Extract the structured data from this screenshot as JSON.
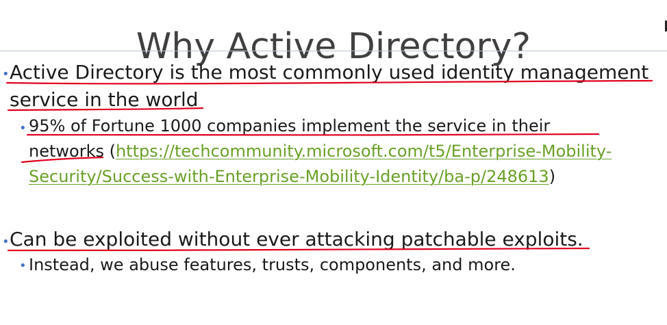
{
  "slide": {
    "title": "Why Active Directory?",
    "bullet_glyph": "•",
    "bullets": [
      {
        "text": "Active Directory is the most commonly used identity management service in the world",
        "sub": {
          "text_before": "95% of Fortune 1000 companies implement the service in their networks (",
          "link_text": "https://techcommunity.microsoft.com/t5/Enterprise-Mobility-Security/Success-with-Enterprise-Mobility-Identity/ba-p/248613",
          "text_after": ")"
        }
      },
      {
        "text": "Can be exploited without ever attacking patchable exploits.",
        "sub": {
          "text": "Instead, we abuse features, trusts, components, and more."
        }
      }
    ]
  },
  "colors": {
    "title": "#404040",
    "bullet": "#4472c4",
    "link": "#6a9f28",
    "annotation_ink": "#e00020"
  }
}
